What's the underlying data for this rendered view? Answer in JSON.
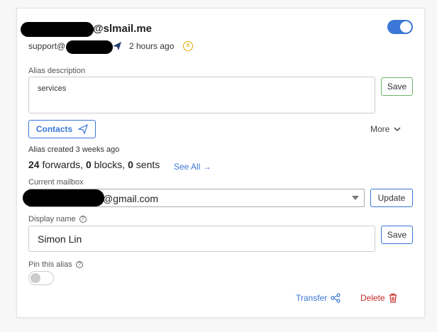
{
  "alias": {
    "email_suffix": "@slmail.me",
    "sender_prefix": "support@",
    "last_used": "2 hours ago",
    "enabled": true
  },
  "description": {
    "label": "Alias description",
    "value": "services",
    "save_label": "Save"
  },
  "actions": {
    "contacts_label": "Contacts",
    "more_label": "More"
  },
  "stats": {
    "created": "Alias created 3 weeks ago",
    "forwards": "24",
    "forwards_word": "forwards,",
    "blocks": "0",
    "blocks_word": "blocks,",
    "sents": "0",
    "sents_word": "sents",
    "see_all": "See All →"
  },
  "mailbox": {
    "label": "Current mailbox",
    "value_suffix": "@gmail.com",
    "update_label": "Update"
  },
  "display_name": {
    "label": "Display name",
    "help": "?",
    "value": "Simon Lin",
    "save_label": "Save"
  },
  "pin": {
    "label": "Pin this alias",
    "help": "?",
    "enabled": false
  },
  "footer": {
    "transfer_label": "Transfer",
    "delete_label": "Delete"
  },
  "colors": {
    "accent": "#3a77d6",
    "danger": "#c62828",
    "warning": "#e3a900",
    "success_border": "#6cb56c"
  }
}
